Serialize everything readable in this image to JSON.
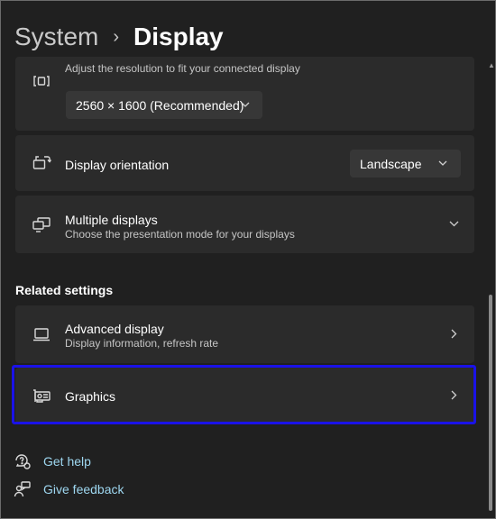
{
  "breadcrumb": {
    "parent": "System",
    "separator": "›",
    "current": "Display"
  },
  "resolution": {
    "description": "Adjust the resolution to fit your connected display",
    "value": "2560 × 1600 (Recommended)"
  },
  "orientation": {
    "label": "Display orientation",
    "value": "Landscape"
  },
  "multiple_displays": {
    "label": "Multiple displays",
    "description": "Choose the presentation mode for your displays"
  },
  "related": {
    "title": "Related settings",
    "advanced_display": {
      "label": "Advanced display",
      "description": "Display information, refresh rate"
    },
    "graphics": {
      "label": "Graphics"
    }
  },
  "links": {
    "get_help": "Get help",
    "give_feedback": "Give feedback"
  },
  "colors": {
    "background": "#202020",
    "card": "#2b2b2b",
    "link": "#9ed7f0",
    "highlight": "#1a12e8"
  }
}
